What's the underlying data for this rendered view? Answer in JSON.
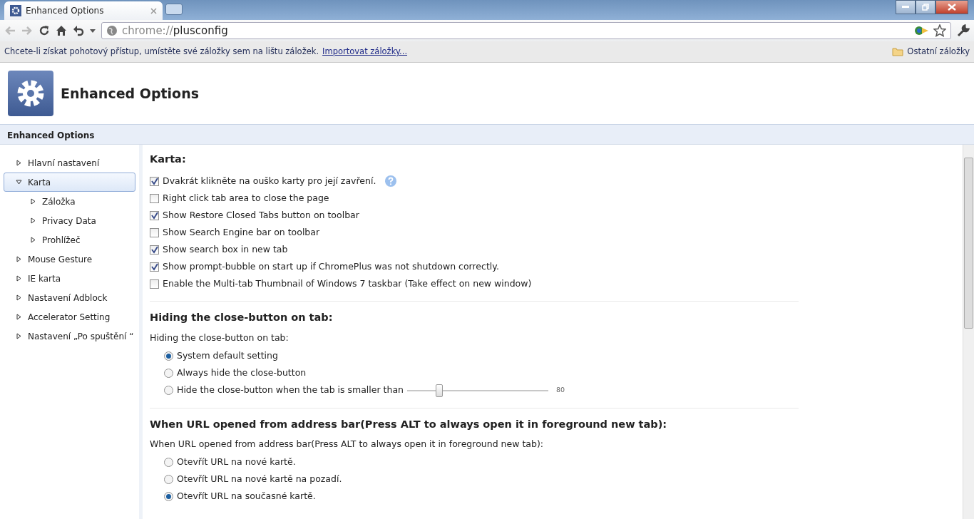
{
  "window": {
    "tab_title": "Enhanced Options"
  },
  "toolbar": {
    "url_scheme": "chrome://",
    "url_path": "plusconfig"
  },
  "bookmarks_bar": {
    "message": "Chcete-li získat pohotový přístup, umístěte své záložky sem na lištu záložek.",
    "import_link": "Importovat záložky...",
    "other_bookmarks": "Ostatní záložky"
  },
  "page_header": {
    "title": "Enhanced Options"
  },
  "section_bar": {
    "title": "Enhanced Options"
  },
  "sidebar": {
    "items": [
      {
        "label": "Hlavní nastavení",
        "expanded": false,
        "selected": false
      },
      {
        "label": "Karta",
        "expanded": true,
        "selected": true,
        "children": [
          {
            "label": "Záložka",
            "expanded": false,
            "selected": false
          },
          {
            "label": "Privacy Data",
            "expanded": false,
            "selected": false
          },
          {
            "label": "Prohlížeč",
            "expanded": false,
            "selected": false
          }
        ]
      },
      {
        "label": "Mouse Gesture",
        "expanded": false,
        "selected": false
      },
      {
        "label": "IE karta",
        "expanded": false,
        "selected": false
      },
      {
        "label": "Nastavení Adblock",
        "expanded": false,
        "selected": false
      },
      {
        "label": "Accelerator Setting",
        "expanded": false,
        "selected": false
      },
      {
        "label": "Nastavení „Po spuštění  “",
        "expanded": false,
        "selected": false
      }
    ]
  },
  "sections": [
    {
      "heading": "Karta:",
      "checkboxes": [
        {
          "label": "Dvakrát klikněte na ouško karty pro její zavření.",
          "checked": true,
          "help": true
        },
        {
          "label": "Right click tab area to close the page",
          "checked": false,
          "help": false
        },
        {
          "label": "Show Restore Closed Tabs button on toolbar",
          "checked": true,
          "help": false
        },
        {
          "label": "Show Search Engine bar on toolbar",
          "checked": false,
          "help": false
        },
        {
          "label": "Show search box in new tab",
          "checked": true,
          "help": false
        },
        {
          "label": "Show prompt-bubble on start up if ChromePlus was not shutdown correctly.",
          "checked": true,
          "help": false
        },
        {
          "label": "Enable the Multi-tab Thumbnail of Windows 7 taskbar (Take effect on new window)",
          "checked": false,
          "help": false
        }
      ]
    },
    {
      "heading": "Hiding the close-button on tab:",
      "prompt": "Hiding the close-button on tab:",
      "options": [
        {
          "kind": "radio",
          "label": "System default setting",
          "selected": true
        },
        {
          "kind": "radio",
          "label": "Always hide the close-button",
          "selected": false
        },
        {
          "kind": "radio-slider",
          "label": "Hide the close-button when the tab is smaller than",
          "selected": false,
          "level": 0.21,
          "reading": "80"
        }
      ]
    },
    {
      "heading": "When URL opened from address bar(Press ALT to always open it in foreground new tab):",
      "prompt": "When URL opened from address bar(Press ALT to always open it in foreground new tab):",
      "options": [
        {
          "kind": "radio",
          "label": "Otevřít URL na nové kartě.",
          "selected": false
        },
        {
          "kind": "radio",
          "label": "Otevřít URL na nové kartě na pozadí.",
          "selected": false
        },
        {
          "kind": "radio",
          "label": "Otevřít URL na současné kartě.",
          "selected": true
        }
      ]
    }
  ]
}
